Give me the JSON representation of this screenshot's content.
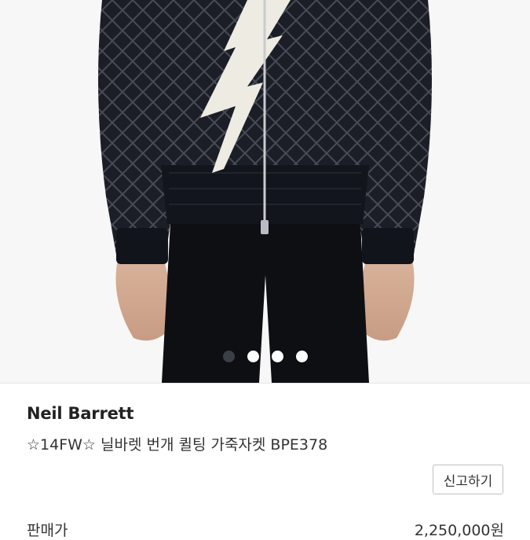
{
  "product_image": {
    "alt_icon": "product-photo",
    "pagination": {
      "total": 4,
      "active_index": 0
    }
  },
  "product": {
    "brand": "Neil Barrett",
    "title": "☆14FW☆ 닐바렛 번개 퀼팅 가죽자켓 BPE378",
    "report_label": "신고하기",
    "price_label": "판매가",
    "price_value": "2,250,000원"
  },
  "colors": {
    "jacket": "#1b1e26",
    "bolt": "#eeebe3",
    "active_dot": "#3a3f46"
  }
}
